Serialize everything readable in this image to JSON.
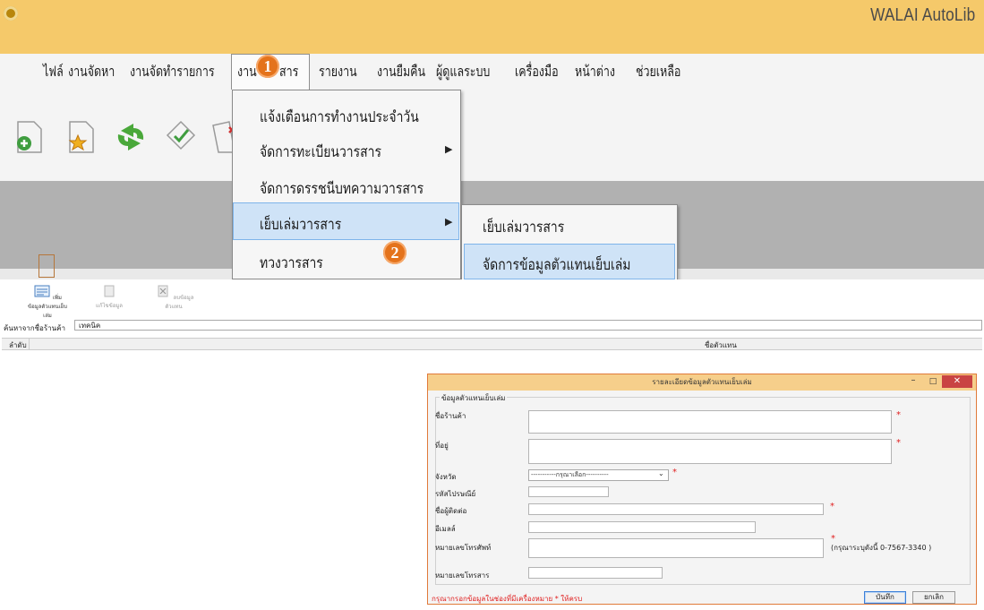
{
  "app": {
    "title": "WALAI AutoLib"
  },
  "menubar": {
    "items": [
      {
        "label": "ไฟล์"
      },
      {
        "label": "งานจัดหา"
      },
      {
        "label": "งานจัดทำรายการ"
      },
      {
        "label": "งานวารสาร"
      },
      {
        "label": "รายงาน"
      },
      {
        "label": "งานยืมคืน"
      },
      {
        "label": "ผู้ดูแลระบบ"
      },
      {
        "label": "เครื่องมือ"
      },
      {
        "label": "หน้าต่าง"
      },
      {
        "label": "ช่วยเหลือ"
      }
    ],
    "active_partial": "งาน",
    "active_partial_end": "สาร"
  },
  "dropdown": {
    "items": [
      {
        "label": "แจ้งเตือนการทำงานประจำวัน",
        "has_submenu": false
      },
      {
        "label": "จัดการทะเบียนวารสาร",
        "has_submenu": true
      },
      {
        "label": "จัดการดรรชนีบทความวารสาร",
        "has_submenu": false
      },
      {
        "label": "เย็บเล่มวารสาร",
        "has_submenu": true,
        "highlighted": true
      },
      {
        "label": "ทวงวารสาร",
        "has_submenu": false
      }
    ],
    "arrow": "▶"
  },
  "submenu": {
    "items": [
      {
        "label": "เย็บเล่มวารสาร"
      },
      {
        "label": "จัดการข้อมูลตัวแทนเย็บเล่ม",
        "highlighted": true
      }
    ]
  },
  "steps": {
    "one": "1",
    "two": "2"
  },
  "form_window": {
    "toolbar": {
      "add_label": "เพิ่มข้อมูลตัวแทนเย็บเล่ม",
      "edit_label": "แก้ไขข้อมูล",
      "delete_label": "ลบข้อมูลตัวแทน"
    },
    "search": {
      "label": "ค้นหาจากชื่อร้านค้า",
      "value": "เทคนิค"
    },
    "grid": {
      "columns": [
        "ลำดับ",
        "ชื่อตัวแทน"
      ]
    }
  },
  "dialog": {
    "title": "รายละเอียดข้อมูลตัวแทนเย็บเล่ม",
    "group_label": "ข้อมูลตัวแทนเย็บเล่ม",
    "fields": {
      "shop_name": "ชื่อร้านค้า",
      "address": "ที่อยู่",
      "province": "จังหวัด",
      "postal_code": "รหัสไปรษณีย์",
      "contact": "ชื่อผู้ติดต่อ",
      "email": "อีเมลล์",
      "phone": "หมายเลขโทรศัพท์",
      "fax": "หมายเลขโทรสาร"
    },
    "province_placeholder": "-----------กรุณาเลือก----------",
    "phone_hint": "(กรุณาระบุดังนี้ 0-7567-3340 )",
    "required_mark": "*",
    "footer_note": "กรุณากรอกข้อมูลในช่องที่มีเครื่องหมาย * ให้ครบ",
    "save_label": "บันทึก",
    "cancel_label": "ยกเลิก",
    "min_glyph": "–",
    "max_glyph": "□",
    "close_glyph": "✕"
  },
  "colors": {
    "titlebar": "#f5c96a",
    "highlight": "#cfe3f7",
    "step_badge": "#e4731c",
    "required": "#e02020",
    "dialog_titlebar": "#f6cf8b",
    "close_button": "#c94343"
  }
}
